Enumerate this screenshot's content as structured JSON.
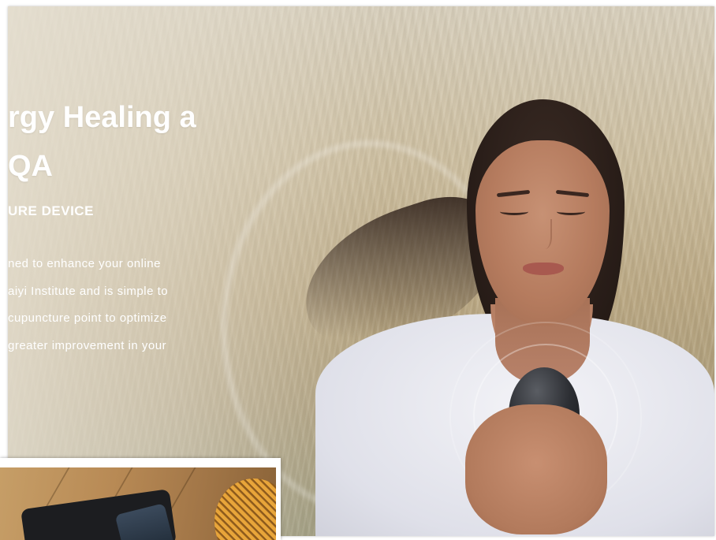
{
  "hero": {
    "title_line1": "rgy Healing a",
    "title_line2": "QA",
    "subtitle": "URE DEVICE",
    "description_lines": [
      "ned to enhance your online",
      "aiyi Institute and is simple to",
      "cupuncture point to optimize",
      "greater improvement in your"
    ]
  },
  "images": {
    "main": "woman-meditating-holding-device",
    "inset": "tablet-phone-on-wooden-floor-with-lamp"
  }
}
